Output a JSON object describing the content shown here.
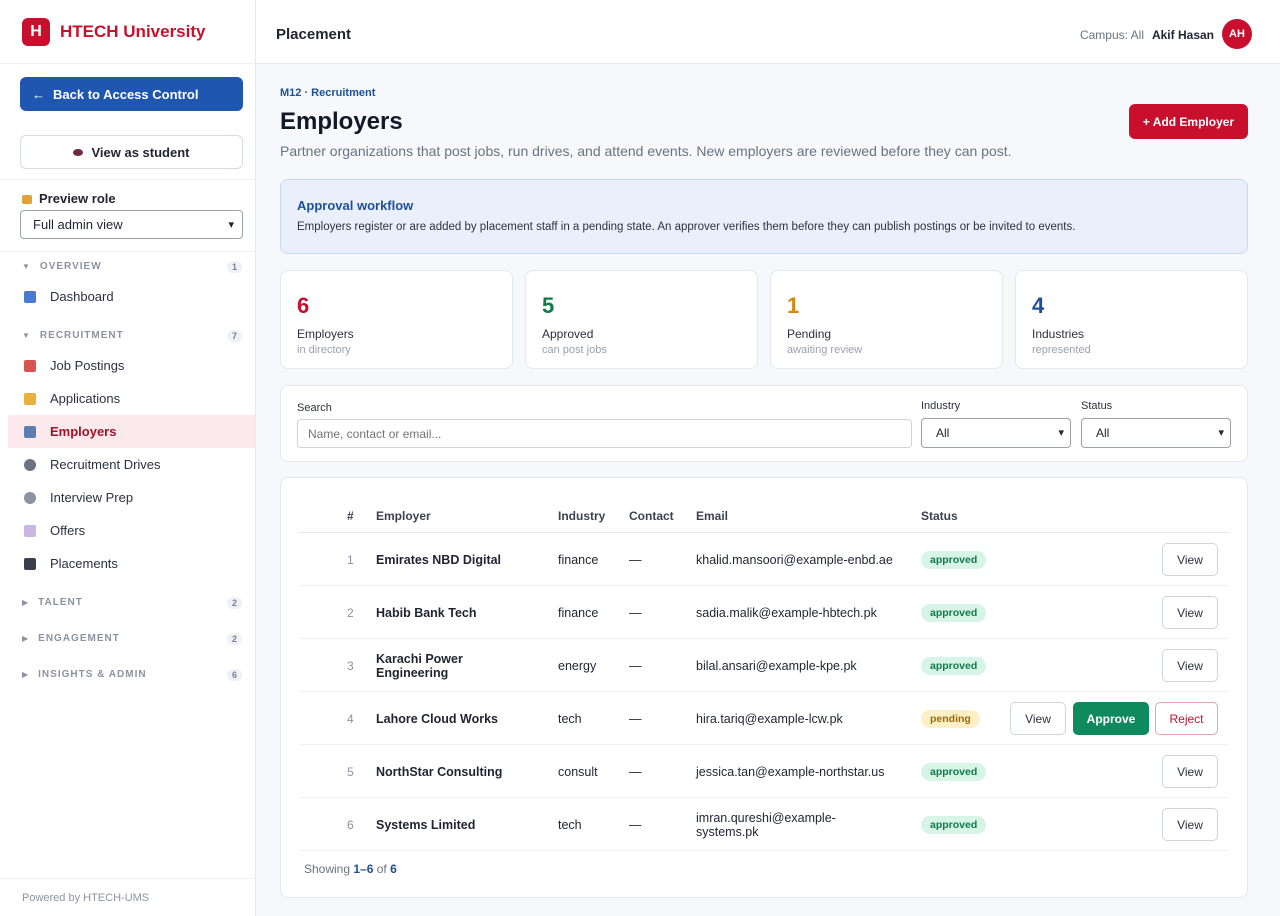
{
  "brand": {
    "logo_letter": "H",
    "name": "HTECH University"
  },
  "sidebar": {
    "back_button": "Back to Access Control",
    "back_arrow": "←",
    "view_student_button": "View as student",
    "preview_role_label": "Preview role",
    "preview_role_value": "Full admin view",
    "sections": [
      {
        "label": "OVERVIEW",
        "count": "1",
        "expanded": true
      },
      {
        "label": "RECRUITMENT",
        "count": "7",
        "expanded": true
      },
      {
        "label": "TALENT",
        "count": "2",
        "expanded": false
      },
      {
        "label": "ENGAGEMENT",
        "count": "2",
        "expanded": false
      },
      {
        "label": "INSIGHTS & ADMIN",
        "count": "6",
        "expanded": false
      }
    ],
    "items": [
      {
        "label": "Dashboard",
        "icon": "chart-icon",
        "color": "#4a7bd0"
      },
      {
        "label": "Job Postings",
        "icon": "clipboard-icon",
        "color": "#d9534f"
      },
      {
        "label": "Applications",
        "icon": "folder-icon",
        "color": "#e8b23a"
      },
      {
        "label": "Employers",
        "icon": "building-icon",
        "color": "#5b7fb3",
        "active": true
      },
      {
        "label": "Recruitment Drives",
        "icon": "microphone-icon",
        "color": "#6b7280"
      },
      {
        "label": "Interview Prep",
        "icon": "mic-stand-icon",
        "color": "#8b93a1"
      },
      {
        "label": "Offers",
        "icon": "envelope-icon",
        "color": "#c9b6e4"
      },
      {
        "label": "Placements",
        "icon": "graduation-cap-icon",
        "color": "#3b3f4a"
      }
    ],
    "footer": "Powered by HTECH-UMS"
  },
  "topbar": {
    "title": "Placement",
    "campus": "Campus: All",
    "user_name": "Akif Hasan",
    "avatar_initials": "AH"
  },
  "page": {
    "breadcrumb": "M12 · Recruitment",
    "title": "Employers",
    "subtitle": "Partner organizations that post jobs, run drives, and attend events. New employers are reviewed before they can post.",
    "add_button": "+ Add Employer"
  },
  "workflow": {
    "title": "Approval workflow",
    "text": "Employers register or are added by placement staff in a pending state. An approver verifies them before they can publish postings or be invited to events."
  },
  "stats": [
    {
      "value": "6",
      "label": "Employers",
      "sub": "in directory",
      "color": "#c8102e"
    },
    {
      "value": "5",
      "label": "Approved",
      "sub": "can post jobs",
      "color": "#0f7a4d"
    },
    {
      "value": "1",
      "label": "Pending",
      "sub": "awaiting review",
      "color": "#d08a0a"
    },
    {
      "value": "4",
      "label": "Industries",
      "sub": "represented",
      "color": "#1e4f9a"
    }
  ],
  "filters": {
    "search_label": "Search",
    "search_placeholder": "Name, contact or email...",
    "industry_label": "Industry",
    "industry_value": "All",
    "status_label": "Status",
    "status_value": "All"
  },
  "table": {
    "headers": {
      "num": "#",
      "employer": "Employer",
      "industry": "Industry",
      "contact": "Contact",
      "email": "Email",
      "status": "Status"
    },
    "rows": [
      {
        "num": "1",
        "employer": "Emirates NBD Digital",
        "industry": "finance",
        "contact": "—",
        "email": "khalid.mansoori@example-enbd.ae",
        "status": "approved"
      },
      {
        "num": "2",
        "employer": "Habib Bank Tech",
        "industry": "finance",
        "contact": "—",
        "email": "sadia.malik@example-hbtech.pk",
        "status": "approved"
      },
      {
        "num": "3",
        "employer": "Karachi Power Engineering",
        "industry": "energy",
        "contact": "—",
        "email": "bilal.ansari@example-kpe.pk",
        "status": "approved"
      },
      {
        "num": "4",
        "employer": "Lahore Cloud Works",
        "industry": "tech",
        "contact": "—",
        "email": "hira.tariq@example-lcw.pk",
        "status": "pending"
      },
      {
        "num": "5",
        "employer": "NorthStar Consulting",
        "industry": "consult",
        "contact": "—",
        "email": "jessica.tan@example-northstar.us",
        "status": "approved"
      },
      {
        "num": "6",
        "employer": "Systems Limited",
        "industry": "tech",
        "contact": "—",
        "email": "imran.qureshi@example-systems.pk",
        "status": "approved"
      }
    ],
    "view_label": "View",
    "approve_label": "Approve",
    "reject_label": "Reject",
    "showing_prefix": "Showing",
    "showing_range": "1–6",
    "showing_of": "of",
    "showing_total": "6"
  }
}
